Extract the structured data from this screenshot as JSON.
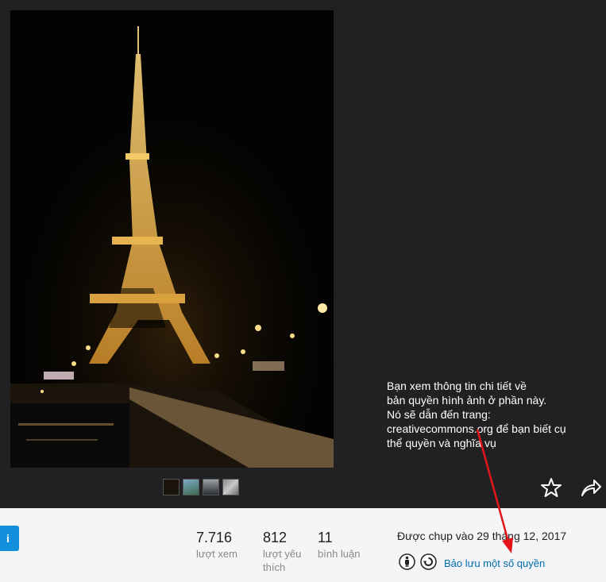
{
  "photo": {
    "alt_icon": "eiffel-tower-night-photo"
  },
  "thumbnails": [
    "thumb-1",
    "thumb-2",
    "thumb-3",
    "thumb-4"
  ],
  "annotation": {
    "text": "Bạn xem thông tin chi tiết về\nbản quyền hình ảnh ở phần này.\nNó sẽ dẫn đến trang:\ncreativecommons.org để bạn biết cụ\nthể quyền và nghĩa vụ"
  },
  "actions": {
    "favorite_icon": "star-icon",
    "share_icon": "share-arrow-icon"
  },
  "info": {
    "follow_label": "i",
    "stats": [
      {
        "value": "7.716",
        "label": "lượt xem"
      },
      {
        "value": "812",
        "label": "lượt yêu thích"
      },
      {
        "value": "11",
        "label": "bình luận"
      }
    ],
    "taken_on": "Được chụp vào 29 tháng 12, 2017",
    "license_text": "Bảo lưu một số quyền",
    "license_icons": [
      "person-attribution-icon",
      "share-alike-icon"
    ]
  },
  "colors": {
    "accent": "#128fdc",
    "link": "#006dac",
    "annotation_arrow": "#e5141b",
    "viewer_bg": "#212124"
  }
}
